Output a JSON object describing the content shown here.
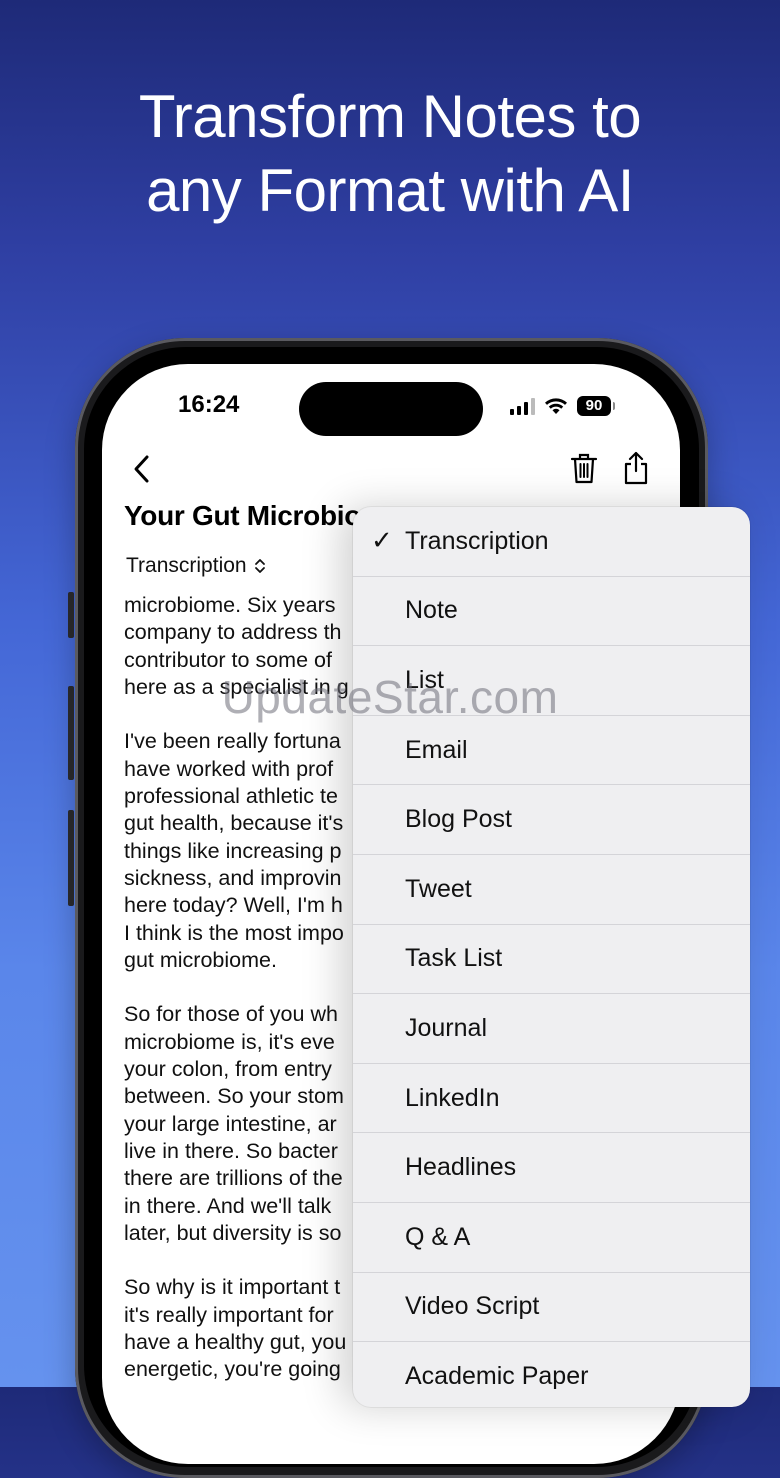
{
  "headline": {
    "line1": "Transform Notes to",
    "line2": "any Format with AI"
  },
  "status_bar": {
    "time": "16:24",
    "battery": "90"
  },
  "toolbar": {
    "back_icon": "chevron-left-icon",
    "trash_icon": "trash-icon",
    "share_icon": "share-icon"
  },
  "document": {
    "title": "Your Gut Microbio",
    "format_selected": "Transcription",
    "paragraphs": [
      [
        "microbiome. Six years",
        "company to address th",
        "contributor to some of",
        "here as a specialist in g"
      ],
      [
        "I've been really fortuna",
        "have worked with prof",
        "professional athletic te",
        "gut health, because it's",
        "things like increasing p",
        "sickness, and improvin",
        "here today? Well, I'm h",
        "I think is the most impo",
        "gut microbiome."
      ],
      [
        "So for those of you wh",
        "microbiome is, it's eve",
        "your colon, from entry",
        "between. So your stom",
        "your large intestine, ar",
        "live in there. So bacter",
        "there are trillions of the",
        "in there. And we'll talk",
        "later, but diversity is so"
      ],
      [
        "So why is it important t",
        "it's really important for",
        "have a healthy gut, you",
        "energetic, you're going"
      ]
    ]
  },
  "format_menu": {
    "selected_mark": "✓",
    "items": [
      "Transcription",
      "Note",
      "List",
      "Email",
      "Blog Post",
      "Tweet",
      "Task List",
      "Journal",
      "LinkedIn",
      "Headlines",
      "Q & A",
      "Video Script",
      "Academic Paper"
    ]
  },
  "watermark": "UpdateStar.com"
}
